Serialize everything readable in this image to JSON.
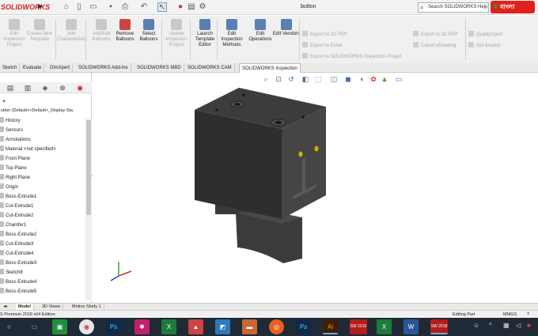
{
  "titlebar": {
    "logo": "SOLIDWORKS",
    "doc_title": "button",
    "help_search": "Search SOLIDWORKS Help",
    "bangla_badge": "বাংলা"
  },
  "command_manager": {
    "buttons": [
      {
        "label": "Edit Inspection Project",
        "enabled": false
      },
      {
        "label": "Create New Template",
        "enabled": false
      },
      {
        "label": "Add Characteristic",
        "enabled": false
      },
      {
        "label": "Add/Edit Balloons",
        "enabled": false
      },
      {
        "label": "Remove Balloons",
        "enabled": true
      },
      {
        "label": "Select Balloons",
        "enabled": true
      },
      {
        "label": "Update Inspection Project",
        "enabled": false
      },
      {
        "label": "Launch Template Editor",
        "enabled": true
      },
      {
        "label": "Edit Inspection Methods",
        "enabled": true
      },
      {
        "label": "Edit Operations",
        "enabled": true
      },
      {
        "label": "Edit Vendors",
        "enabled": true
      }
    ],
    "export_links_1": [
      "Export to 2D PDF",
      "Export to Excel",
      "Export to SOLIDWORKS Inspection Project"
    ],
    "export_links_2": [
      "Export to 3D PDF",
      "Export eDrawing"
    ],
    "export_links_3": [
      "QualityXpert",
      "Net-Inspect"
    ]
  },
  "tabs": [
    "Sketch",
    "Evaluate",
    "DimXpert",
    "SOLIDWORKS Add-Ins",
    "SOLIDWORKS MBD",
    "SOLIDWORKS CAM",
    "SOLIDWORKS Inspection"
  ],
  "active_tab": "SOLIDWORKS Inspection",
  "feature_tree": {
    "root": "utton  (Default<<Default>_Display Sta",
    "items": [
      "History",
      "Sensors",
      "Annotations",
      "Material <not specified>",
      "Front Plane",
      "Top Plane",
      "Right Plane",
      "Origin",
      "Boss-Extrude1",
      "Cut-Extrude1",
      "Cut-Extrude2",
      "Chamfer1",
      "Boss-Extrude2",
      "Cut-Extrude3",
      "Cut-Extrude4",
      "Boss-Extrude3",
      "Sketch8",
      "Boss-Extrude4",
      "Boss-Extrude5"
    ]
  },
  "bottom_tabs": [
    "Model",
    "3D Views",
    "Motion Study 1"
  ],
  "active_bottom_tab": "Model",
  "status": {
    "left": "S Premium 2018 x64 Edition",
    "editing": "Editing Part",
    "units": "MMGS"
  },
  "taskbar": {
    "apps": [
      "Ps",
      "Ps",
      "Ai",
      "SW 2016",
      "SW 2018"
    ]
  }
}
